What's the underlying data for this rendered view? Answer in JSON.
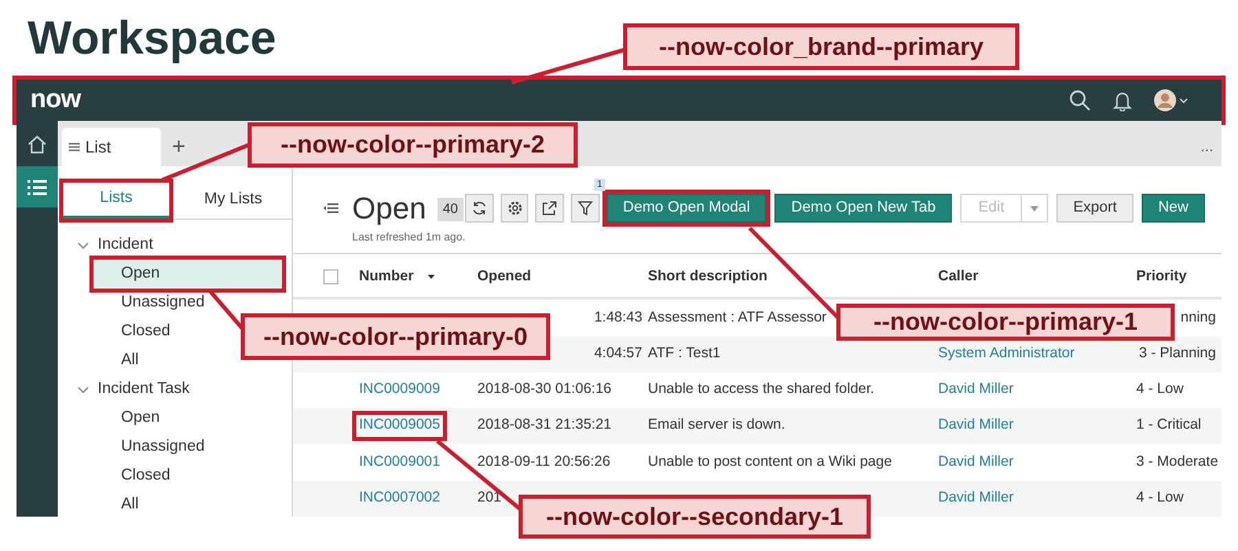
{
  "title": "Workspace",
  "navbar": {
    "logo": "now",
    "highlighted": true
  },
  "tabs": [
    {
      "label": "List",
      "selected": true
    }
  ],
  "add_tab": "+",
  "more": "...",
  "panel_tabs": [
    {
      "label": "Lists",
      "selected": true,
      "highlighted": true
    },
    {
      "label": "My Lists",
      "selected": false,
      "highlighted": false
    }
  ],
  "tree": [
    {
      "label": "Incident",
      "expanded": true,
      "children": [
        {
          "label": "Open",
          "selected": true,
          "highlighted": true
        },
        {
          "label": "Unassigned",
          "selected": false,
          "highlighted": false
        },
        {
          "label": "Closed",
          "selected": false,
          "highlighted": false
        },
        {
          "label": "All",
          "selected": false,
          "highlighted": false
        }
      ]
    },
    {
      "label": "Incident Task",
      "expanded": true,
      "children": [
        {
          "label": "Open",
          "selected": false,
          "highlighted": false
        },
        {
          "label": "Unassigned",
          "selected": false,
          "highlighted": false
        },
        {
          "label": "Closed",
          "selected": false,
          "highlighted": false
        },
        {
          "label": "All",
          "selected": false,
          "highlighted": false
        }
      ]
    }
  ],
  "list": {
    "title": "Open",
    "count": "40",
    "refreshed": "Last refreshed 1m ago.",
    "filter_count": "1"
  },
  "buttons": [
    {
      "label": "Demo Open Modal",
      "kind": "primary",
      "disabled": false,
      "highlighted": true
    },
    {
      "label": "Demo Open New Tab",
      "kind": "primary",
      "disabled": false,
      "highlighted": false
    },
    {
      "label": "Edit",
      "kind": "split",
      "disabled": true,
      "highlighted": false
    },
    {
      "label": "Export",
      "kind": "secondary",
      "disabled": false,
      "highlighted": false
    },
    {
      "label": "New",
      "kind": "primary",
      "disabled": false,
      "highlighted": false
    }
  ],
  "table": {
    "select_all": {
      "checked": false
    },
    "columns": [
      "Number",
      "Opened",
      "Short description",
      "Caller",
      "Priority"
    ],
    "rows": [
      {
        "kind": "covered",
        "opened": "1:48:43",
        "description": "Assessment : ATF Assessor",
        "priority": "nning"
      },
      {
        "kind": "covered",
        "opened": "4:04:57",
        "description": "ATF : Test1",
        "caller": "System Administrator",
        "priority": "3 - Planning"
      },
      {
        "kind": "plain",
        "number": "INC0009009",
        "opened": "2018-08-30 01:06:16",
        "description": "Unable to access the shared folder.",
        "caller": "David Miller",
        "priority": "4 - Low",
        "highlighted": false
      },
      {
        "kind": "plain",
        "number": "INC0009005",
        "opened": "2018-08-31 21:35:21",
        "description": "Email server is down.",
        "caller": "David Miller",
        "priority": "1 - Critical",
        "highlighted": true
      },
      {
        "kind": "plain",
        "number": "INC0009001",
        "opened": "2018-09-11 20:56:26",
        "description": "Unable to post content on a Wiki page",
        "caller": "David Miller",
        "priority": "3 - Moderate",
        "highlighted": false
      },
      {
        "kind": "plain",
        "number": "INC0007002",
        "opened": "201",
        "caller": "David Miller",
        "priority": "4 - Low",
        "highlighted": false
      }
    ]
  },
  "callouts": [
    {
      "label": "--now-color_brand--primary"
    },
    {
      "label": "--now-color--primary-2"
    },
    {
      "label": "--now-color--primary-0"
    },
    {
      "label": "--now-color--primary-1"
    },
    {
      "label": "--now-color--secondary-1"
    }
  ]
}
